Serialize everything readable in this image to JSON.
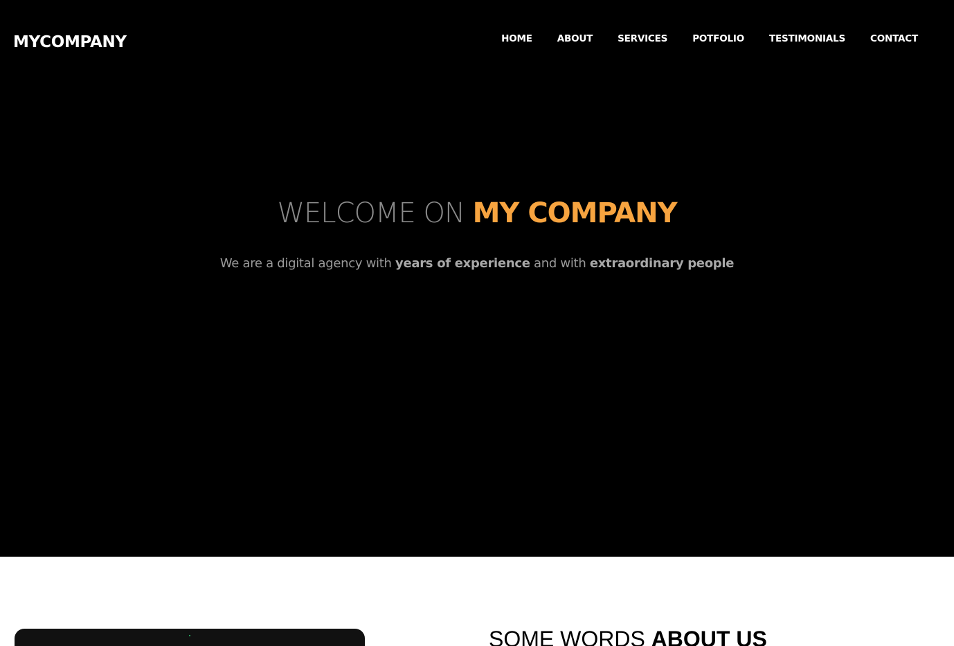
{
  "brand": "MYCOMPANY",
  "nav": [
    {
      "label": "HOME"
    },
    {
      "label": "ABOUT"
    },
    {
      "label": "SERVICES"
    },
    {
      "label": "POTFOLIO"
    },
    {
      "label": "TESTIMONIALS"
    },
    {
      "label": "CONTACT"
    }
  ],
  "hero": {
    "title_light": "WELCOME ON ",
    "title_accent": "MY COMPANY",
    "sub_1": "We are a digital agency with ",
    "sub_bold_1": "years of experience",
    "sub_2": " and with ",
    "sub_bold_2": "extraordinary people"
  },
  "about": {
    "heading_light": "SOME WORDS ",
    "heading_bold": "ABOUT US"
  },
  "colors": {
    "accent": "#f7a440",
    "hero_bg": "#000000",
    "body_bg": "#ffffff"
  }
}
